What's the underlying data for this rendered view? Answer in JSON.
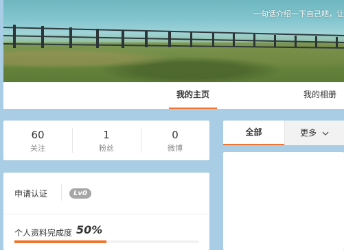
{
  "cover": {
    "top_text": "",
    "bio": "一句话介绍一下自己吧，让"
  },
  "nav": {
    "tabs": [
      {
        "label": "我的主页",
        "active": true
      },
      {
        "label": "我的相册",
        "active": false
      }
    ]
  },
  "stats": [
    {
      "value": "60",
      "label": "关注"
    },
    {
      "value": "1",
      "label": "粉丝"
    },
    {
      "value": "0",
      "label": "微博"
    }
  ],
  "verify": {
    "label": "申请认证",
    "level_badge": "Lv0"
  },
  "profile": {
    "label": "个人资料完成度",
    "value": "50%",
    "fraction": 0.5
  },
  "feed_tabs": {
    "all": "全部",
    "more": "更多"
  },
  "colors": {
    "accent": "#f0742f",
    "background": "#a9cde4"
  }
}
